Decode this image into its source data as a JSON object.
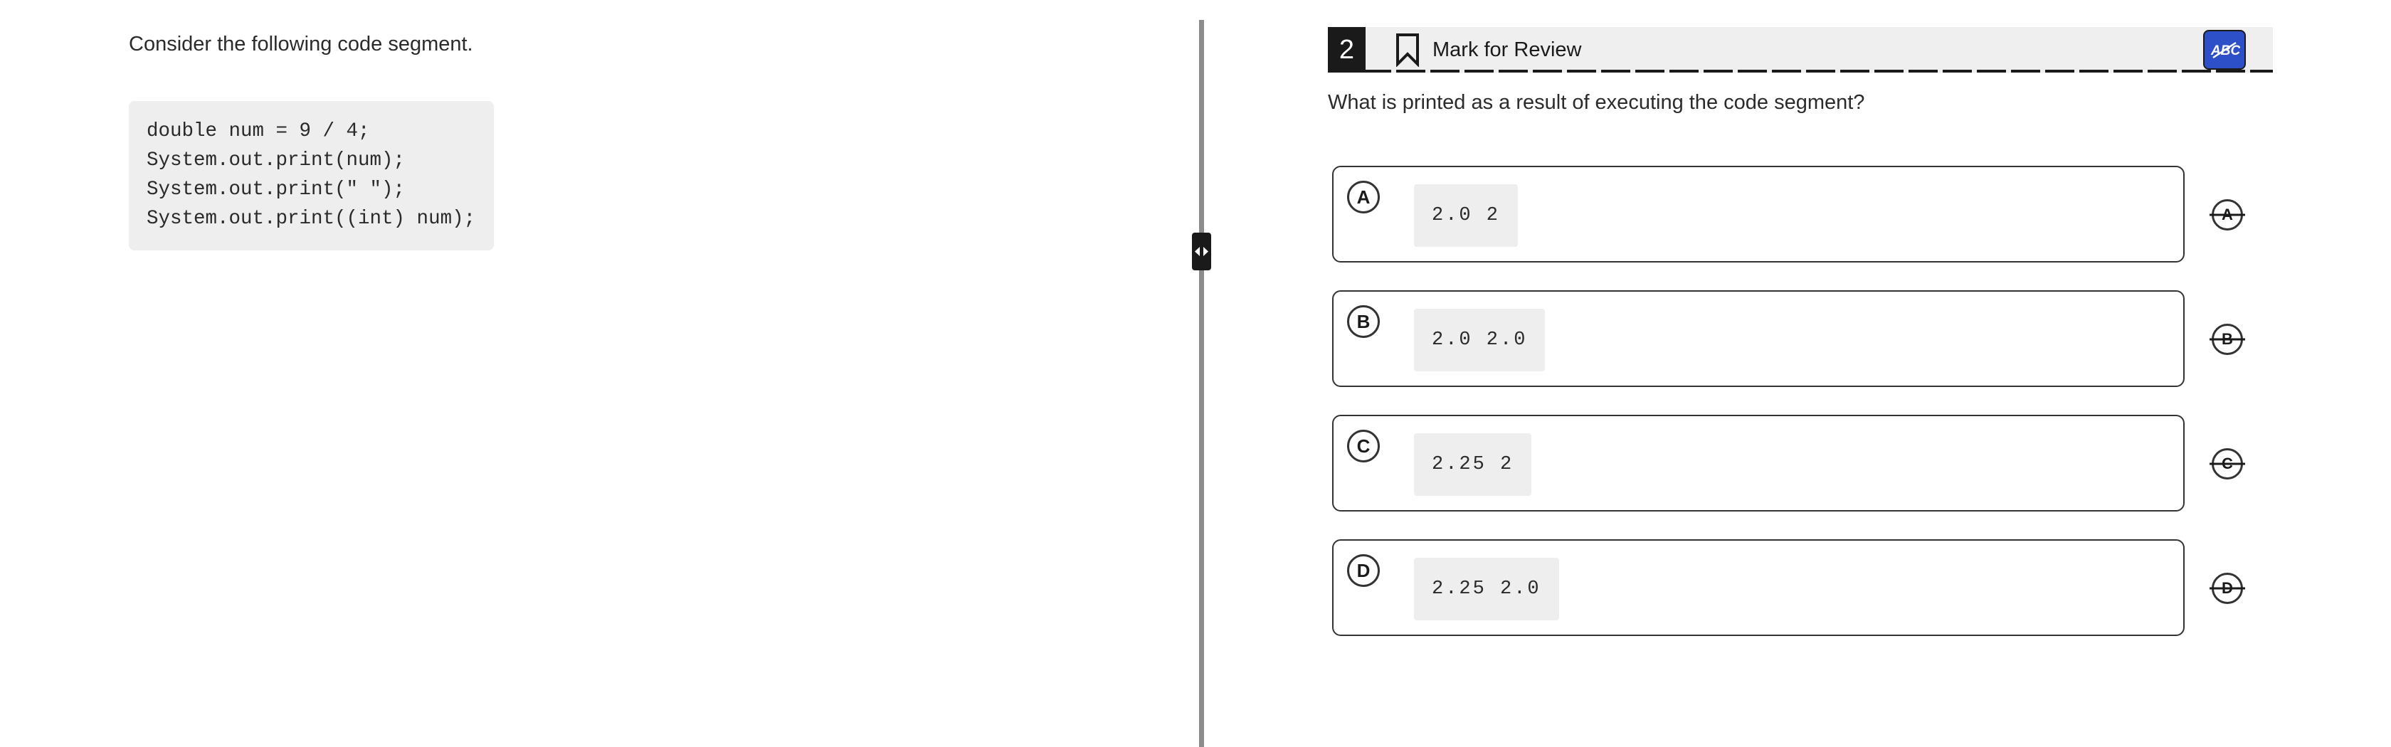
{
  "passage": {
    "intro": "Consider the following code segment.",
    "code_lines": [
      "double num = 9 / 4;",
      "System.out.print(num);",
      "System.out.print(\" \");",
      "System.out.print((int) num);"
    ]
  },
  "header": {
    "question_number": "2",
    "mark_for_review_label": "Mark for Review",
    "tool_icon": "abc-strikethrough-icon"
  },
  "question": {
    "prompt": "What is printed as a result of executing the code segment?"
  },
  "choices": [
    {
      "letter": "A",
      "code": "2.0 2"
    },
    {
      "letter": "B",
      "code": "2.0 2.0"
    },
    {
      "letter": "C",
      "code": "2.25 2"
    },
    {
      "letter": "D",
      "code": "2.25 2.0"
    }
  ],
  "colors": {
    "accent_tool": "#2d4fc7",
    "number_badge": "#1a1a1a",
    "header_bg": "#efefef",
    "code_bg": "#eeeeee"
  }
}
